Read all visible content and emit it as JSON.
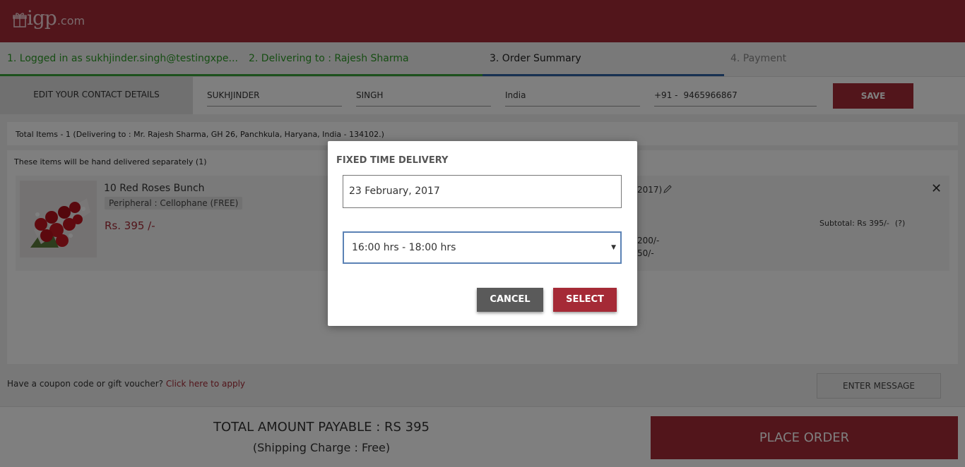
{
  "brand": {
    "logo_word": "igp",
    "logo_domain": ".com",
    "accent": "#a52a36"
  },
  "steps": [
    {
      "label": "1. Logged in as sukhjinder.singh@testingxpe..."
    },
    {
      "label": "2. Delivering to : Rajesh Sharma"
    },
    {
      "label": "3. Order Summary"
    },
    {
      "label": "4. Payment"
    }
  ],
  "contact": {
    "label": "EDIT YOUR CONTACT DETAILS",
    "first_name": "SUKHJINDER",
    "last_name": "SINGH",
    "country": "India",
    "country_code": "+91 -",
    "phone": "9465966867",
    "save_label": "SAVE"
  },
  "summary": {
    "total_items": "Total Items - 1 (Delivering to : Mr. Rajesh Sharma, GH 26, Panchkula, Haryana, India - 134102.)",
    "section_title": "These items will be hand delivered separately (1)"
  },
  "item": {
    "name": "10 Red Roses Bunch",
    "tag": "Peripheral : Cellophane (FREE)",
    "price": "Rs. 395 /-",
    "date_fragment": "2017)",
    "charge1": "200/-",
    "charge2": "50/-",
    "subtotal": "Subtotal: Rs 395/-",
    "help": "(?)",
    "close": "✕"
  },
  "coupon": {
    "text": "Have a coupon code or gift voucher?",
    "link": "Click here to apply"
  },
  "message_button": "ENTER MESSAGE",
  "footer": {
    "total": "TOTAL AMOUNT PAYABLE : RS 395",
    "shipping": "(Shipping Charge : Free)",
    "place_order": "PLACE ORDER"
  },
  "modal": {
    "title": "FIXED TIME DELIVERY",
    "date_value": "23 February, 2017",
    "time_value": "16:00 hrs - 18:00 hrs",
    "caret": "▼",
    "cancel_label": "CANCEL",
    "select_label": "SELECT"
  }
}
